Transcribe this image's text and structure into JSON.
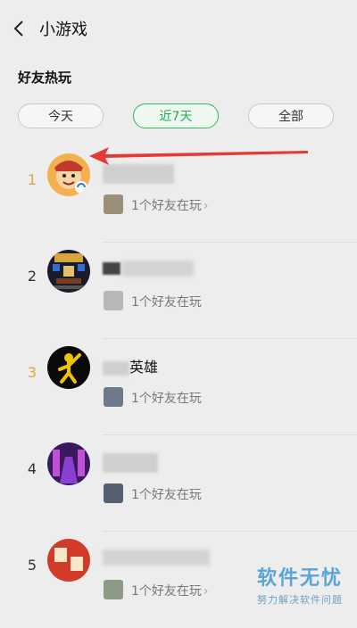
{
  "header": {
    "title": "小游戏",
    "back_icon": "back-arrow-icon"
  },
  "section_title": "好友热玩",
  "tabs": [
    {
      "label": "今天",
      "active": false
    },
    {
      "label": "近7天",
      "active": true
    },
    {
      "label": "全部",
      "active": false
    }
  ],
  "games": [
    {
      "rank": "1",
      "name": "",
      "friends": "1个好友在玩",
      "chevron": "›"
    },
    {
      "rank": "2",
      "name": "",
      "friends": "1个好友在玩"
    },
    {
      "rank": "3",
      "name": "英雄",
      "friends": "1个好友在玩"
    },
    {
      "rank": "4",
      "name": "",
      "friends": "1个好友在玩"
    },
    {
      "rank": "5",
      "name": "",
      "friends": "1个好友在玩",
      "chevron": "›"
    }
  ],
  "watermark": {
    "big": "软件无忧",
    "small": "努力解决软件问题"
  },
  "colors": {
    "accent_green": "#2aa852",
    "rank_top": "#e6a23c",
    "arrow_red": "#e53935"
  }
}
